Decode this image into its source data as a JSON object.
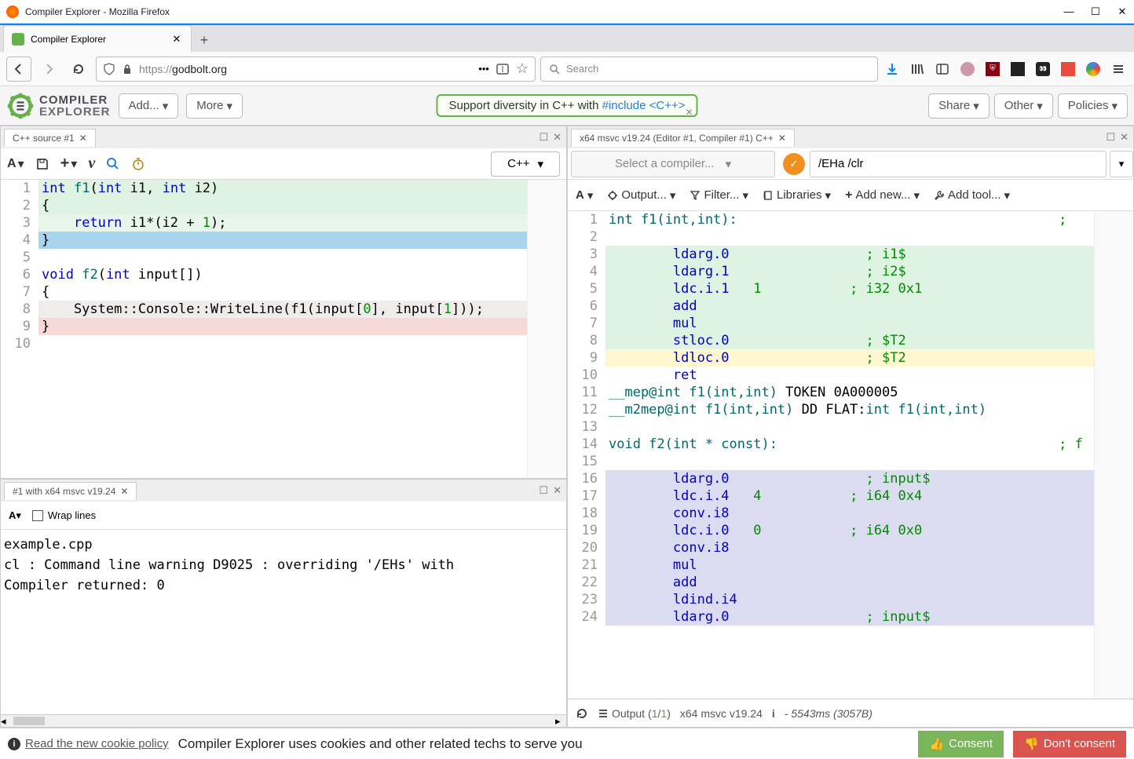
{
  "window": {
    "title": "Compiler Explorer - Mozilla Firefox"
  },
  "tab": {
    "title": "Compiler Explorer"
  },
  "url": {
    "scheme": "https://",
    "domain": "godbolt.org"
  },
  "search": {
    "placeholder": "Search"
  },
  "ce_header": {
    "logo1": "COMPILER",
    "logo2": "EXPLORER",
    "add": "Add...",
    "more": "More",
    "banner1": "Support diversity in C++ with ",
    "banner_link": "#include <C++>",
    "share": "Share",
    "other": "Other",
    "policies": "Policies"
  },
  "source_pane": {
    "tab": "C++ source #1",
    "lang": "C++",
    "lines": [
      {
        "n": 1,
        "cls": "bg-green",
        "html": "<span class='kw'>int</span> <span class='fn'>f1</span>(<span class='kw'>int</span> i1, <span class='kw'>int</span> i2)"
      },
      {
        "n": 2,
        "cls": "bg-green",
        "html": "{"
      },
      {
        "n": 3,
        "cls": "bg-l3",
        "html": "    <span class='kw'>return</span> i1*(i2 + <span class='num'>1</span>);"
      },
      {
        "n": 4,
        "cls": "bg-blue",
        "html": "}"
      },
      {
        "n": 5,
        "cls": "",
        "html": ""
      },
      {
        "n": 6,
        "cls": "",
        "html": "<span class='kw'>void</span> <span class='fn'>f2</span>(<span class='kw'>int</span> input[])"
      },
      {
        "n": 7,
        "cls": "",
        "html": "{"
      },
      {
        "n": 8,
        "cls": "bg-l8",
        "html": "    System::Console::WriteLine(f1(input[<span class='num'>0</span>], input[<span class='num'>1</span>]));"
      },
      {
        "n": 9,
        "cls": "bg-pink",
        "html": "}"
      },
      {
        "n": 10,
        "cls": "",
        "html": ""
      }
    ]
  },
  "compiler_pane": {
    "tab": "x64 msvc v19.24 (Editor #1, Compiler #1) C++",
    "selector": "Select a compiler...",
    "flags": "/EHa /clr",
    "output": "Output...",
    "filter": "Filter...",
    "libraries": "Libraries",
    "addnew": "Add new...",
    "addtool": "Add tool...",
    "lines": [
      {
        "n": 1,
        "cls": "",
        "html": "<span class='label-c'>int f1(int,int):</span>                                        <span class='comment'>;</span>"
      },
      {
        "n": 2,
        "cls": "",
        "html": ""
      },
      {
        "n": 3,
        "cls": "bg-green",
        "html": "        <span class='kw'>ldarg.0</span>                 <span class='comment'>; i1$</span>"
      },
      {
        "n": 4,
        "cls": "bg-green",
        "html": "        <span class='kw'>ldarg.1</span>                 <span class='comment'>; i2$</span>"
      },
      {
        "n": 5,
        "cls": "bg-green",
        "html": "        <span class='kw'>ldc.i.1</span>   <span class='num'>1</span>           <span class='comment'>; i32 0x1</span>"
      },
      {
        "n": 6,
        "cls": "bg-green",
        "html": "        <span class='kw'>add</span>"
      },
      {
        "n": 7,
        "cls": "bg-green",
        "html": "        <span class='kw'>mul</span>"
      },
      {
        "n": 8,
        "cls": "bg-green",
        "html": "        <span class='kw'>stloc.0</span>                 <span class='comment'>; $T2</span>"
      },
      {
        "n": 9,
        "cls": "bg-yellow",
        "html": "        <span class='kw'>ldloc.0</span>                 <span class='comment'>; $T2</span>"
      },
      {
        "n": 10,
        "cls": "",
        "html": "        <span class='kw'>ret</span>"
      },
      {
        "n": 11,
        "cls": "",
        "html": "<span class='label-c'>__mep@int f1(int,int)</span> TOKEN 0A000005"
      },
      {
        "n": 12,
        "cls": "",
        "html": "<span class='label-c'>__m2mep@int f1(int,int)</span> DD FLAT:<span class='label-c'>int f1(int,int)</span>"
      },
      {
        "n": 13,
        "cls": "",
        "html": ""
      },
      {
        "n": 14,
        "cls": "",
        "html": "<span class='label-c'>void f2(int * const):</span>                                   <span class='comment'>; f</span>"
      },
      {
        "n": 15,
        "cls": "",
        "html": ""
      },
      {
        "n": 16,
        "cls": "bg-purple",
        "html": "        <span class='kw'>ldarg.0</span>                 <span class='comment'>; input$</span>"
      },
      {
        "n": 17,
        "cls": "bg-purple",
        "html": "        <span class='kw'>ldc.i.4</span>   <span class='num'>4</span>           <span class='comment'>; i64 0x4</span>"
      },
      {
        "n": 18,
        "cls": "bg-purple",
        "html": "        <span class='kw'>conv.i8</span>"
      },
      {
        "n": 19,
        "cls": "bg-purple",
        "html": "        <span class='kw'>ldc.i.0</span>   <span class='num'>0</span>           <span class='comment'>; i64 0x0</span>"
      },
      {
        "n": 20,
        "cls": "bg-purple",
        "html": "        <span class='kw'>conv.i8</span>"
      },
      {
        "n": 21,
        "cls": "bg-purple",
        "html": "        <span class='kw'>mul</span>"
      },
      {
        "n": 22,
        "cls": "bg-purple",
        "html": "        <span class='kw'>add</span>"
      },
      {
        "n": 23,
        "cls": "bg-purple",
        "html": "        <span class='kw'>ldind.i4</span>"
      },
      {
        "n": 24,
        "cls": "bg-purple",
        "html": "        <span class='kw'>ldarg.0</span>                 <span class='comment'>; input$</span>"
      }
    ],
    "status": {
      "output_label": "Output",
      "out_counts": "(1/1)",
      "compiler": "x64 msvc v19.24",
      "time": "- 5543ms (3057B)"
    }
  },
  "output_pane": {
    "tab": "#1 with x64 msvc v19.24",
    "wrap": "Wrap lines",
    "lines": [
      "example.cpp",
      "cl : Command line warning D9025 : overriding '/EHs' with",
      "Compiler returned: 0"
    ]
  },
  "cookie": {
    "link": "Read the new cookie policy",
    "msg": "Compiler Explorer uses cookies and other related techs to serve you",
    "yes": "Consent",
    "no": "Don't consent"
  }
}
